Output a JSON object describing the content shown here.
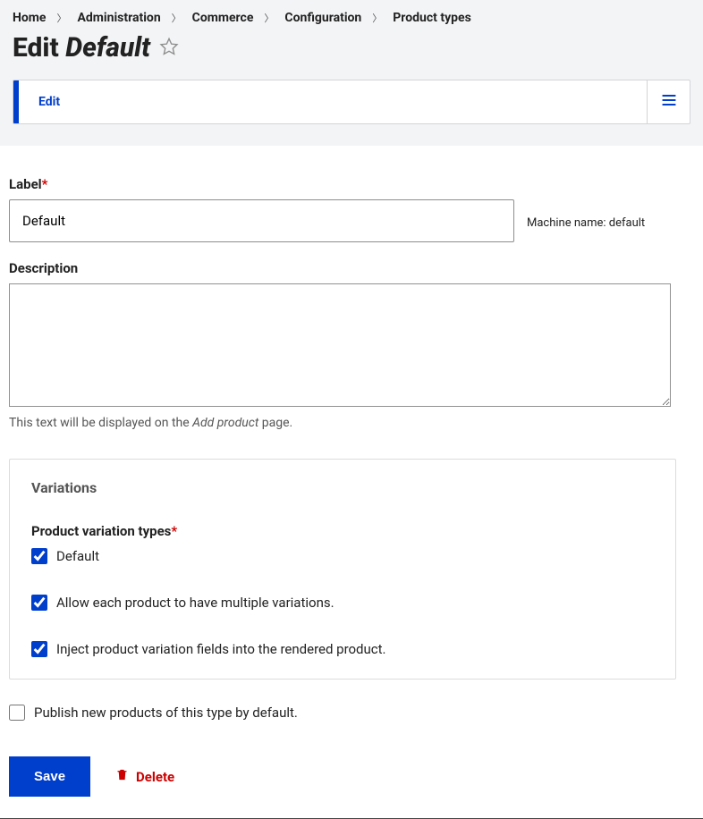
{
  "breadcrumb": {
    "home": "Home",
    "administration": "Administration",
    "commerce": "Commerce",
    "configuration": "Configuration",
    "product_types": "Product types"
  },
  "page_title": {
    "prefix": "Edit",
    "name": "Default"
  },
  "tabs": {
    "edit": "Edit"
  },
  "form": {
    "label_field": {
      "label": "Label",
      "value": "Default"
    },
    "machine_name": {
      "prefix": "Machine name:",
      "value": "default"
    },
    "description": {
      "label": "Description",
      "value": "",
      "help_before": "This text will be displayed on the ",
      "help_italic": "Add product",
      "help_after": " page."
    },
    "variations": {
      "legend": "Variations",
      "types_label": "Product variation types",
      "type_default": "Default",
      "allow_multiple": "Allow each product to have multiple variations.",
      "inject_fields": "Inject product variation fields into the rendered product."
    },
    "publish_default": "Publish new products of this type by default."
  },
  "actions": {
    "save": "Save",
    "delete": "Delete"
  }
}
